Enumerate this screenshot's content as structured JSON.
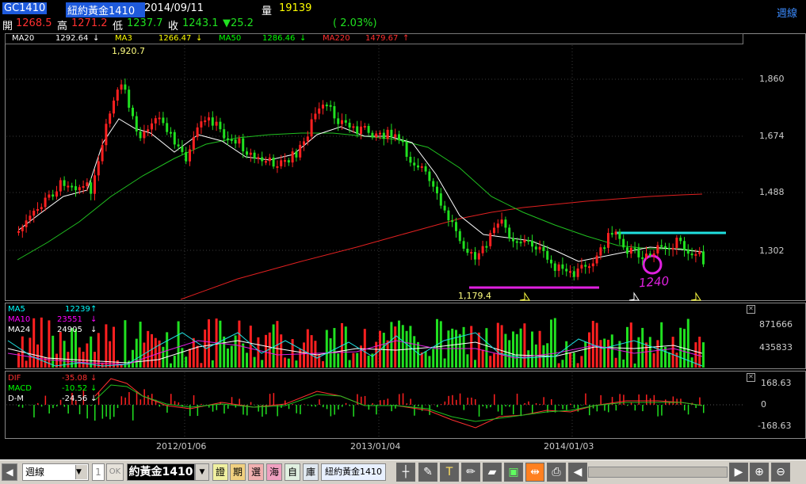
{
  "header": {
    "symbol": "GC1410",
    "name": "紐約黃金1410",
    "date": "2014/09/11",
    "vol_label": "量",
    "vol_value": "19139",
    "period": "週線",
    "open_label": "開",
    "open": "1268.5",
    "high_label": "高",
    "high": "1271.2",
    "low_label": "低",
    "low": "1237.7",
    "close_label": "收",
    "close": "1243.1",
    "change": "▼25.2",
    "change_pct": "( 2.03%)"
  },
  "ma_legend": [
    {
      "label": "MA20",
      "value": "1292.64",
      "arrow": "↓",
      "color": "#ffffff"
    },
    {
      "label": "MA3",
      "value": "1266.47",
      "arrow": "↓",
      "color": "#ffff00"
    },
    {
      "label": "MA50",
      "value": "1286.46",
      "arrow": "↓",
      "color": "#00ff00"
    },
    {
      "label": "MA220",
      "value": "1479.67",
      "arrow": "↑",
      "color": "#ff3030"
    }
  ],
  "annotations": {
    "high_label": "1,920.7",
    "low_label": "1,179.4",
    "handwritten": "1240"
  },
  "price_axis": [
    "1,860",
    "1,674",
    "1,488",
    "1,302"
  ],
  "vol_legend": [
    {
      "label": "MA5",
      "value": "12239",
      "arrow": "↑",
      "color": "#00ffff"
    },
    {
      "label": "MA10",
      "value": "23551",
      "arrow": "↓",
      "color": "#ff00ff"
    },
    {
      "label": "MA24",
      "value": "24905",
      "arrow": "↓",
      "color": "#ffffff"
    }
  ],
  "vol_axis": [
    "871666",
    "435833"
  ],
  "macd_legend": [
    {
      "label": "DIF",
      "value": "-35.08",
      "arrow": "↓",
      "color": "#ff3030"
    },
    {
      "label": "MACD",
      "value": "-10.52",
      "arrow": "↓",
      "color": "#00ff00"
    },
    {
      "label": "D-M",
      "value": "-24.56",
      "arrow": "↓",
      "color": "#ffffff"
    }
  ],
  "macd_axis": [
    "168.63",
    "0",
    "-168.63"
  ],
  "date_axis": [
    "2012/01/06",
    "2013/01/04",
    "2014/01/03"
  ],
  "toolbar": {
    "period_select": "週線",
    "count_value": "1",
    "ok_label": "OK",
    "symbol_input": "約黃金1410",
    "buttons": [
      "證",
      "期",
      "選",
      "海",
      "自",
      "庫"
    ],
    "product_label": "紐約黃金1410"
  },
  "colors": {
    "up": "#ff2020",
    "down": "#20e020",
    "ma20": "#ffffff",
    "ma50": "#20c020",
    "ma220": "#e02020",
    "cyan_line": "#20e0e0",
    "magenta_line": "#e020e0"
  }
}
